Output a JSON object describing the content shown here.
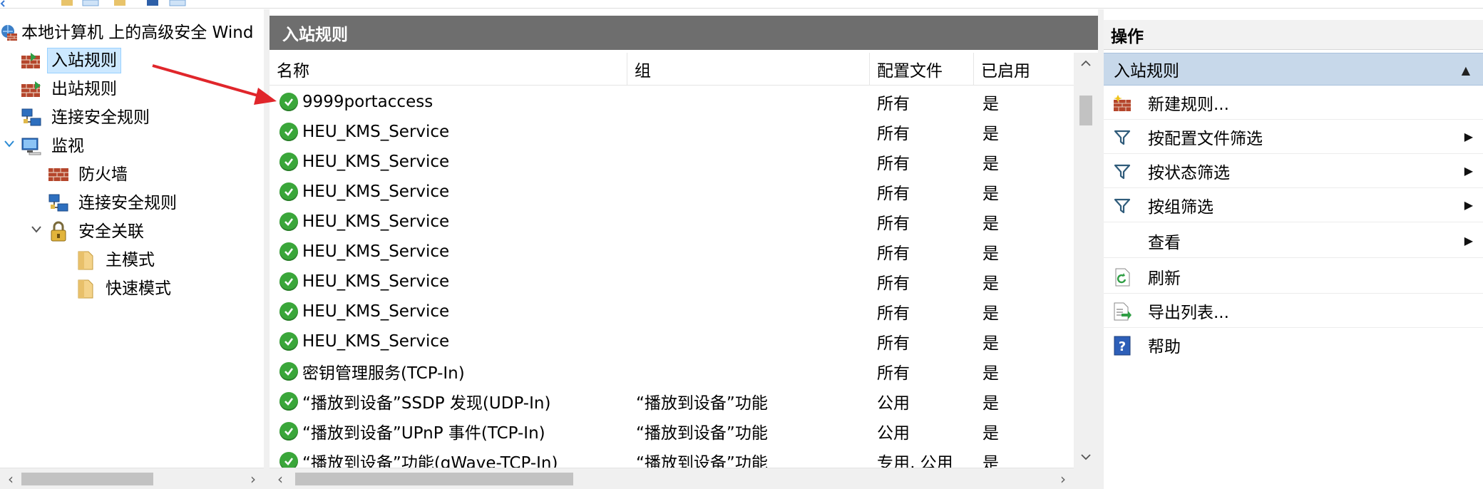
{
  "tree": {
    "root_label": "本地计算机 上的高级安全 Wind",
    "items": [
      {
        "label": "入站规则",
        "selected": true,
        "icon": "firewall-inbound-icon"
      },
      {
        "label": "出站规则",
        "selected": false,
        "icon": "firewall-outbound-icon"
      },
      {
        "label": "连接安全规则",
        "selected": false,
        "icon": "connection-security-icon"
      },
      {
        "label": "监视",
        "selected": false,
        "icon": "monitor-icon"
      },
      {
        "label": "防火墙",
        "selected": false,
        "icon": "firewall-icon"
      },
      {
        "label": "连接安全规则",
        "selected": false,
        "icon": "connection-security-icon"
      },
      {
        "label": "安全关联",
        "selected": false,
        "icon": "lock-icon"
      },
      {
        "label": "主模式",
        "selected": false,
        "icon": "folder-icon"
      },
      {
        "label": "快速模式",
        "selected": false,
        "icon": "folder-icon"
      }
    ]
  },
  "center": {
    "title": "入站规则",
    "columns": [
      "名称",
      "组",
      "配置文件",
      "已启用"
    ],
    "rows": [
      {
        "name": "9999portaccess",
        "group": "",
        "profile": "所有",
        "enabled": "是"
      },
      {
        "name": "HEU_KMS_Service",
        "group": "",
        "profile": "所有",
        "enabled": "是"
      },
      {
        "name": "HEU_KMS_Service",
        "group": "",
        "profile": "所有",
        "enabled": "是"
      },
      {
        "name": "HEU_KMS_Service",
        "group": "",
        "profile": "所有",
        "enabled": "是"
      },
      {
        "name": "HEU_KMS_Service",
        "group": "",
        "profile": "所有",
        "enabled": "是"
      },
      {
        "name": "HEU_KMS_Service",
        "group": "",
        "profile": "所有",
        "enabled": "是"
      },
      {
        "name": "HEU_KMS_Service",
        "group": "",
        "profile": "所有",
        "enabled": "是"
      },
      {
        "name": "HEU_KMS_Service",
        "group": "",
        "profile": "所有",
        "enabled": "是"
      },
      {
        "name": "HEU_KMS_Service",
        "group": "",
        "profile": "所有",
        "enabled": "是"
      },
      {
        "name": "密钥管理服务(TCP-In)",
        "group": "",
        "profile": "所有",
        "enabled": "是"
      },
      {
        "name": "“播放到设备”SSDP 发现(UDP-In)",
        "group": "“播放到设备”功能",
        "profile": "公用",
        "enabled": "是"
      },
      {
        "name": "“播放到设备”UPnP 事件(TCP-In)",
        "group": "“播放到设备”功能",
        "profile": "公用",
        "enabled": "是"
      },
      {
        "name": "“播放到设备”功能(qWave-TCP-In)",
        "group": "“播放到设备”功能",
        "profile": "专用, 公用",
        "enabled": "是"
      }
    ]
  },
  "actions": {
    "title": "操作",
    "section": "入站规则",
    "items": [
      {
        "label": "新建规则...",
        "icon": "new-rule-icon",
        "submenu": false
      },
      {
        "label": "按配置文件筛选",
        "icon": "filter-icon",
        "submenu": true
      },
      {
        "label": "按状态筛选",
        "icon": "filter-icon",
        "submenu": true
      },
      {
        "label": "按组筛选",
        "icon": "filter-icon",
        "submenu": true
      },
      {
        "label": "查看",
        "icon": "",
        "submenu": true
      },
      {
        "label": "刷新",
        "icon": "refresh-icon",
        "submenu": false
      },
      {
        "label": "导出列表...",
        "icon": "export-list-icon",
        "submenu": false
      },
      {
        "label": "帮助",
        "icon": "help-icon",
        "submenu": false
      }
    ]
  },
  "colors": {
    "title_bar": "#6e6e6e",
    "selection": "#cce8ff",
    "action_section": "#c7d8ea",
    "check_green": "#3aa63a",
    "annotation_arrow": "#e0262b"
  }
}
